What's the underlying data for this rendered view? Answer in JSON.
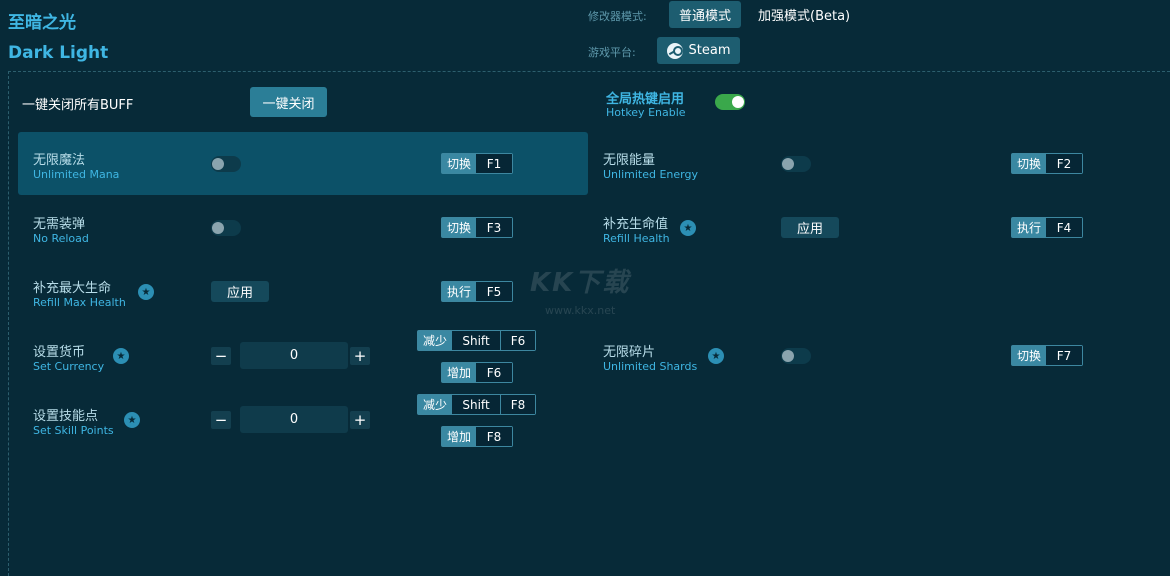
{
  "header": {
    "title_cn": "至暗之光",
    "title_en": "Dark Light",
    "mode_label": "修改器模式:",
    "mode_normal": "普通模式",
    "mode_enhanced": "加强模式(Beta)",
    "platform_label": "游戏平台:",
    "platform": "Steam"
  },
  "controls": {
    "close_all_label": "一键关闭所有BUFF",
    "close_all_button": "一键关闭",
    "hotkey_cn": "全局热键启用",
    "hotkey_en": "Hotkey Enable",
    "hotkey_enabled": true
  },
  "watermark": {
    "main": "KK下载",
    "sub": "www.kkx.net"
  },
  "cheats": [
    {
      "cn": "无限魔法",
      "en": "Unlimited Mana",
      "action": "切换",
      "key": "F1",
      "enabled": false
    },
    {
      "cn": "无限能量",
      "en": "Unlimited Energy",
      "action": "切换",
      "key": "F2",
      "enabled": false
    },
    {
      "cn": "无需装弹",
      "en": "No Reload",
      "action": "切换",
      "key": "F3",
      "enabled": false
    },
    {
      "cn": "补充生命值",
      "en": "Refill Health",
      "action": "执行",
      "key": "F4",
      "apply": "应用"
    },
    {
      "cn": "补充最大生命",
      "en": "Refill Max Health",
      "action": "执行",
      "key": "F5",
      "apply": "应用"
    },
    {
      "cn": "设置货币",
      "en": "Set Currency",
      "value": "0",
      "dec_action": "减少",
      "dec_mod": "Shift",
      "dec_key": "F6",
      "inc_action": "增加",
      "inc_key": "F6"
    },
    {
      "cn": "无限碎片",
      "en": "Unlimited Shards",
      "action": "切换",
      "key": "F7",
      "enabled": false
    },
    {
      "cn": "设置技能点",
      "en": "Set Skill Points",
      "value": "0",
      "dec_action": "减少",
      "dec_mod": "Shift",
      "dec_key": "F8",
      "inc_action": "增加",
      "inc_key": "F8"
    }
  ],
  "icons": {
    "star": "star-icon",
    "steam": "steam-icon",
    "minus": "−",
    "plus": "+"
  },
  "colors": {
    "background": "#072a38",
    "accent": "#3fb6e3",
    "toggle_on": "#3aa84b",
    "highlight_row": "#0c5168"
  }
}
